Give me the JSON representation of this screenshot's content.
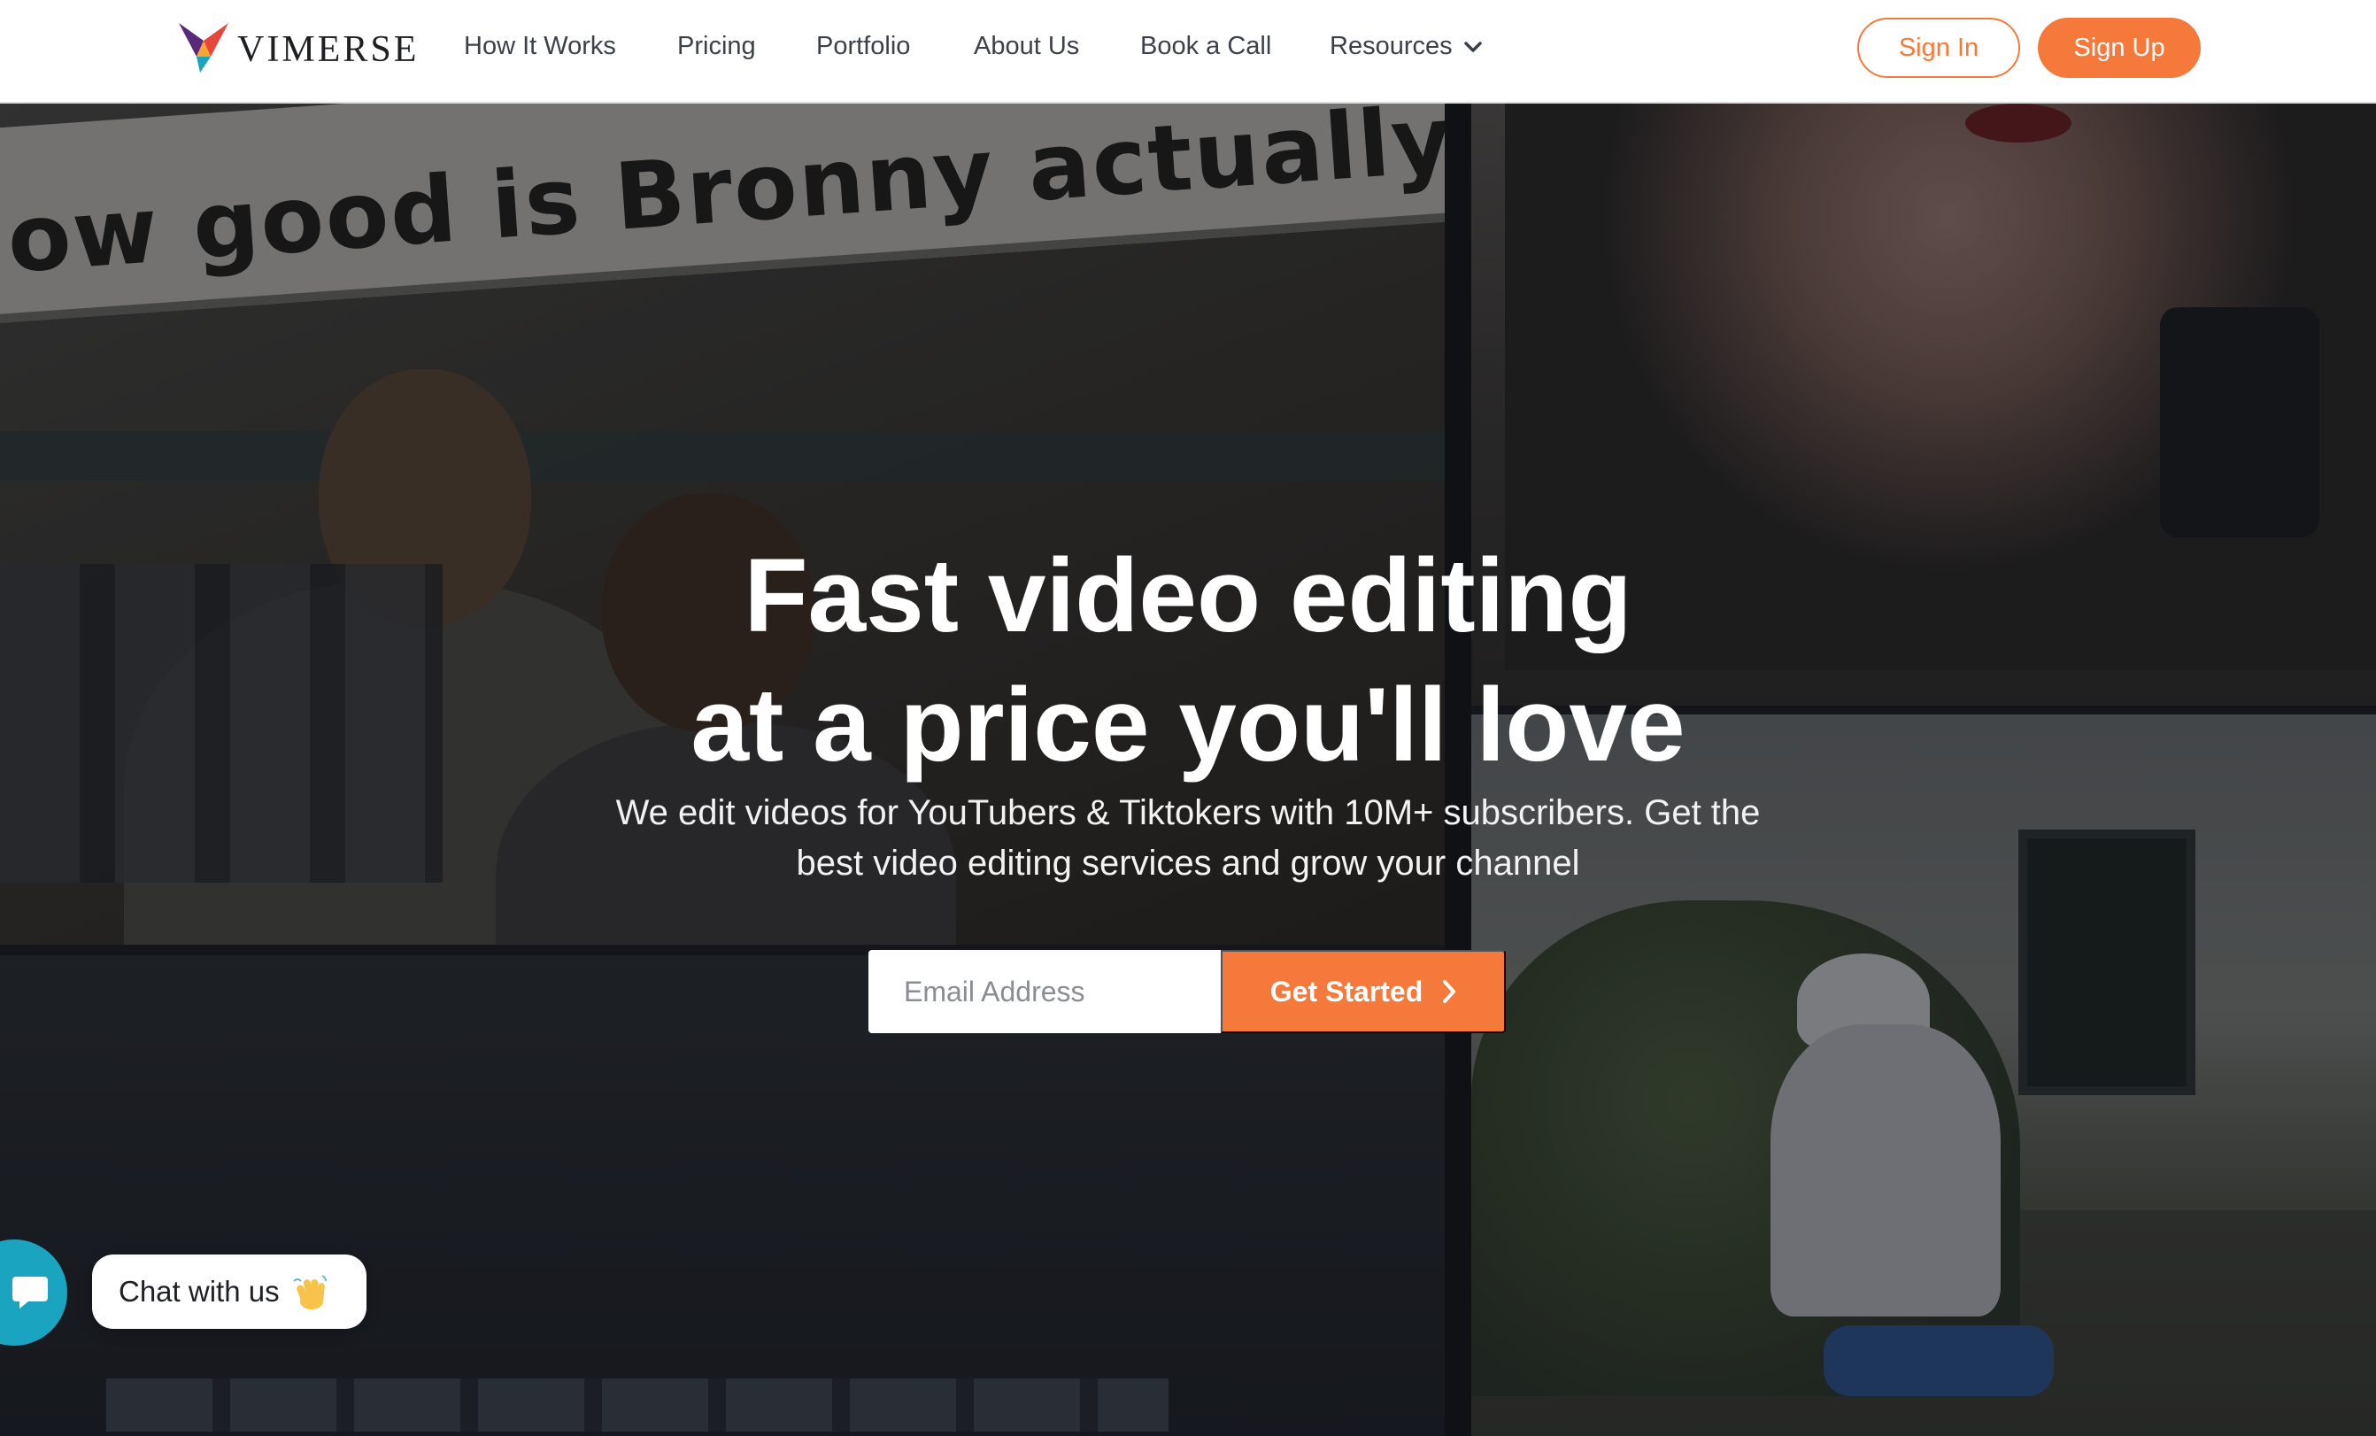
{
  "brand": {
    "name": "VIMERSE",
    "accent_color": "#f5793a",
    "logo_colors": [
      "#e8463c",
      "#5a2a7a",
      "#1aa4bf",
      "#f7a531"
    ]
  },
  "nav": {
    "links": [
      {
        "label": "How It Works"
      },
      {
        "label": "Pricing"
      },
      {
        "label": "Portfolio"
      },
      {
        "label": "About Us"
      },
      {
        "label": "Book a Call"
      },
      {
        "label": "Resources",
        "icon": "chevron-down-icon"
      }
    ],
    "sign_in": "Sign In",
    "sign_up": "Sign Up"
  },
  "hero": {
    "banner_text": "ow good is Bronny actually",
    "title_line1": "Fast video editing",
    "title_line2": "at a price you'll love",
    "subtitle_line1": "We edit videos for YouTubers & Tiktokers with 10M+ subscribers. Get the",
    "subtitle_line2": "best video editing services and grow your channel",
    "email_placeholder": "Email Address",
    "cta_label": "Get Started",
    "cta_icon": "chevron-right-icon"
  },
  "chat": {
    "label": "Chat with us",
    "emoji": "👋",
    "fab_icon": "chat-bubble-icon",
    "fab_color": "#1aa4bf"
  }
}
